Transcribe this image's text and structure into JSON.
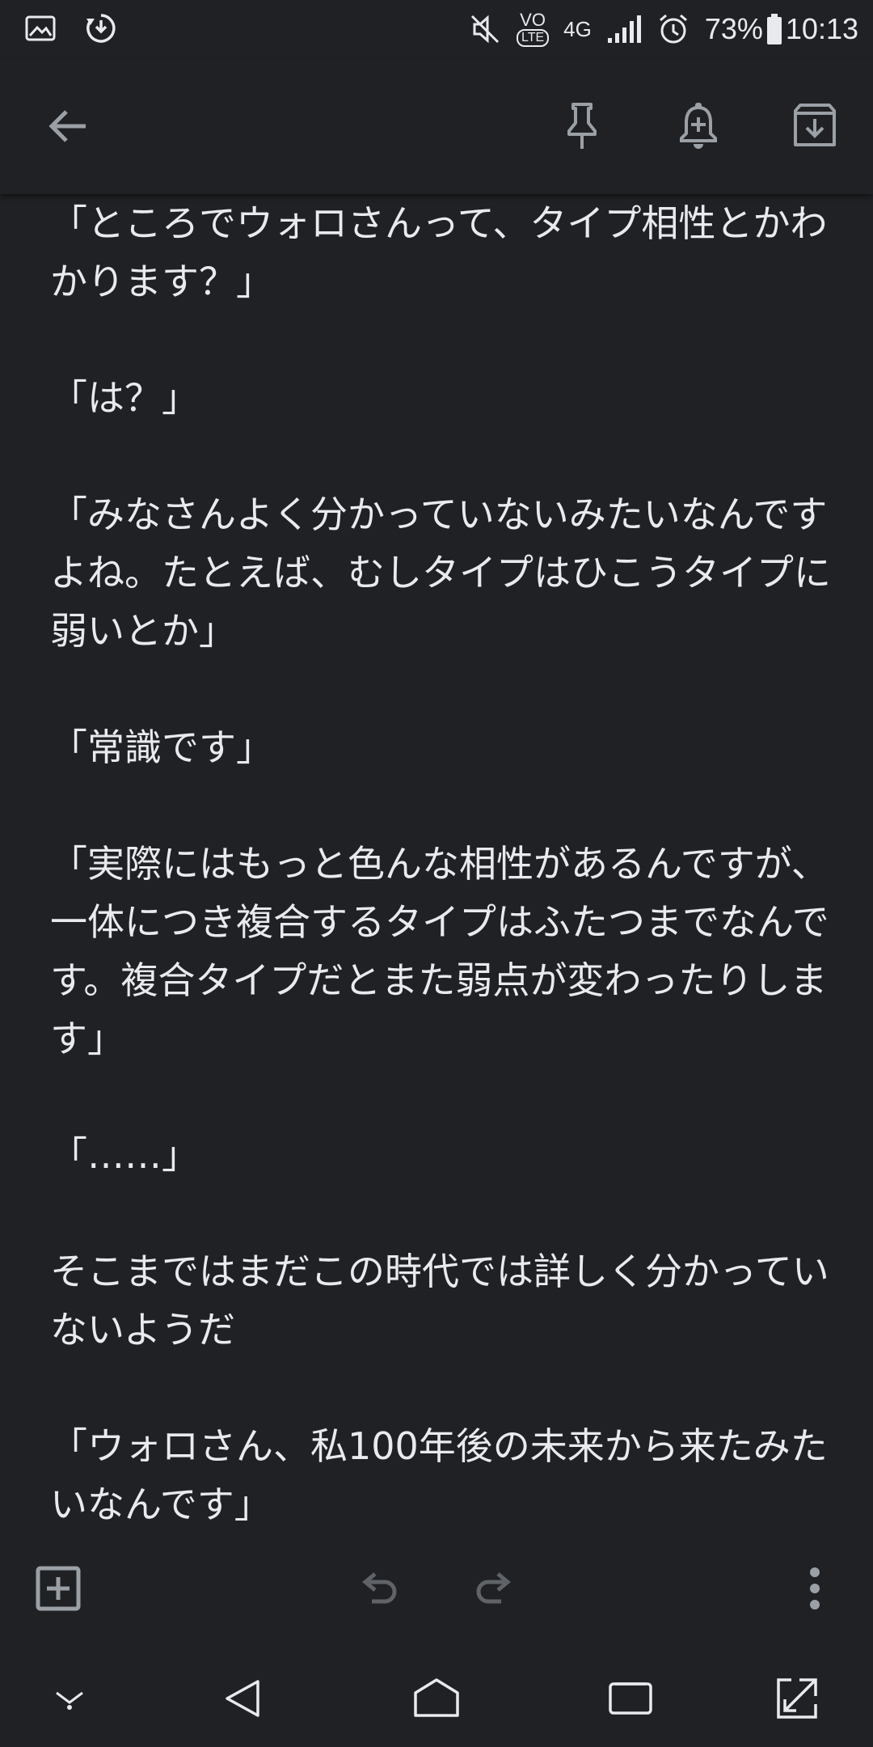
{
  "status_bar": {
    "left_icons": [
      "gallery-notification-icon",
      "download-update-icon"
    ],
    "volte_label": "VO",
    "lte_label": "LTE",
    "network_label": "4G",
    "battery_percent": "73%",
    "time": "10:13"
  },
  "toolbar": {
    "icons": [
      "back-arrow-icon",
      "pin-icon",
      "add-reminder-icon",
      "archive-icon"
    ]
  },
  "note": {
    "body": "「ところでウォロさんって、タイプ相性とかわかります？」\n\n「は？」\n\n「みなさんよく分かっていないみたいなんですよね。たとえば、むしタイプはひこうタイプに弱いとか」\n\n「常識です」\n\n「実際にはもっと色んな相性があるんですが、一体につき複合するタイプはふたつまでなんです。複合タイプだとまた弱点が変わったりします」\n\n「……」\n\nそこまではまだこの時代では詳しく分かっていないようだ\n\n「ウォロさん、私100年後の未来から来たみたいなんです」\n（これ今思うともっと未来では？）"
  },
  "editor_bar": {
    "icons": [
      "add-box-icon",
      "undo-icon",
      "redo-icon",
      "more-vert-icon"
    ]
  },
  "nav_bar": {
    "icons": [
      "hide-nav-icon",
      "back-triangle-icon",
      "home-icon",
      "recents-icon",
      "screen-expand-icon"
    ]
  },
  "colors": {
    "background": "#202124",
    "text": "#e8eaed",
    "icon": "#9aa0a6"
  }
}
